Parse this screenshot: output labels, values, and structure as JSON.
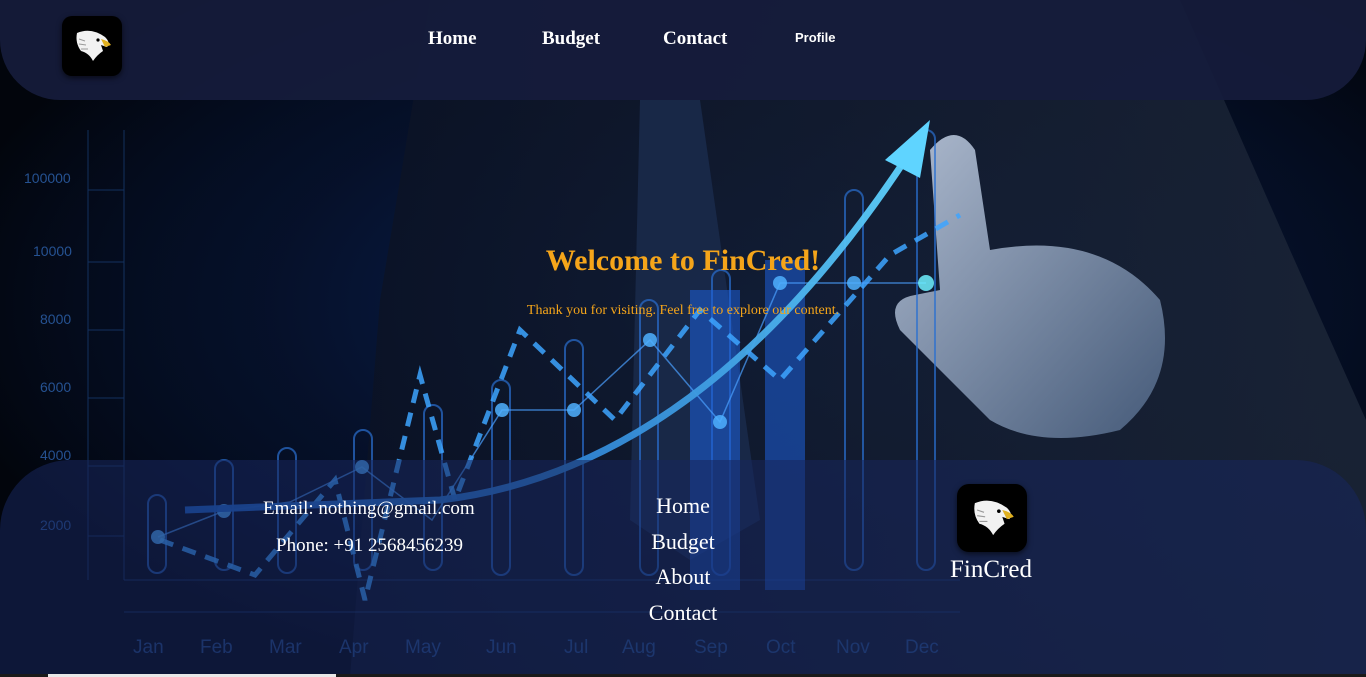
{
  "nav": {
    "logo_icon": "eagle-icon",
    "links": [
      {
        "label": "Home"
      },
      {
        "label": "Budget"
      },
      {
        "label": "Contact"
      }
    ],
    "profile_label": "Profile"
  },
  "hero": {
    "title": "Welcome to FinCred!",
    "subtitle": "Thank you for visiting. Feel free to explore our content.",
    "accent_color": "#f5a51a"
  },
  "background_chart": {
    "y_ticks": [
      "100000",
      "10000",
      "8000",
      "6000",
      "4000",
      "2000"
    ],
    "x_ticks": [
      "Jan",
      "Feb",
      "Mar",
      "Apr",
      "May",
      "Jun",
      "Jul",
      "Aug",
      "Sep",
      "Oct",
      "Nov",
      "Dec"
    ]
  },
  "footer": {
    "email": "Email: nothing@gmail.com",
    "phone": "Phone: +91 2568456239",
    "links": [
      {
        "label": "Home"
      },
      {
        "label": "Budget"
      },
      {
        "label": "About"
      },
      {
        "label": "Contact"
      }
    ],
    "brand": "FinCred",
    "logo_icon": "eagle-icon"
  }
}
